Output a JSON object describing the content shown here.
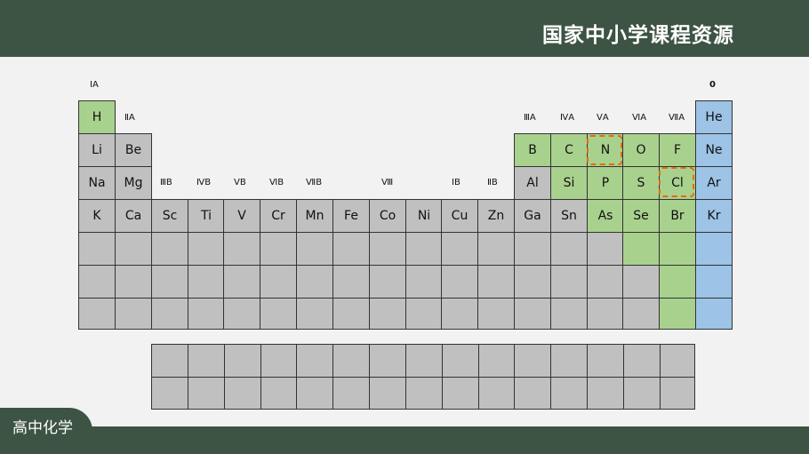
{
  "header": {
    "site_title": "国家中小学课程资源"
  },
  "footer": {
    "subject": "高中化学"
  },
  "group_labels": {
    "IA": "ⅠA",
    "IIA": "ⅡA",
    "IIIB": "ⅢB",
    "IVB": "ⅣB",
    "VB": "ⅤB",
    "VIB": "ⅥB",
    "VIIB": "ⅦB",
    "VIII": "Ⅷ",
    "IB": "ⅠB",
    "IIB": "ⅡB",
    "IIIA": "ⅢA",
    "IVA": "ⅣA",
    "VA": "ⅤA",
    "VIA": "ⅥA",
    "VIIA": "ⅦA",
    "zero": "0"
  },
  "elements": {
    "H": "H",
    "He": "He",
    "Li": "Li",
    "Be": "Be",
    "B": "B",
    "C": "C",
    "N": "N",
    "O": "O",
    "F": "F",
    "Ne": "Ne",
    "Na": "Na",
    "Mg": "Mg",
    "Al": "Al",
    "Si": "Si",
    "P": "P",
    "S": "S",
    "Cl": "Cl",
    "Ar": "Ar",
    "K": "K",
    "Ca": "Ca",
    "Sc": "Sc",
    "Ti": "Ti",
    "V": "V",
    "Cr": "Cr",
    "Mn": "Mn",
    "Fe": "Fe",
    "Co": "Co",
    "Ni": "Ni",
    "Cu": "Cu",
    "Zn": "Zn",
    "Ga": "Ga",
    "Ge": "Sn",
    "As": "As",
    "Se": "Se",
    "Br": "Br",
    "Kr": "Kr"
  },
  "colors": {
    "header_bg": "#3d5343",
    "metal": "#c0c0c0",
    "nonmetal": "#a9d18e",
    "noble_gas": "#9dc3e6",
    "highlight": "#e46c0a"
  },
  "highlighted_elements": [
    "N",
    "Cl"
  ]
}
